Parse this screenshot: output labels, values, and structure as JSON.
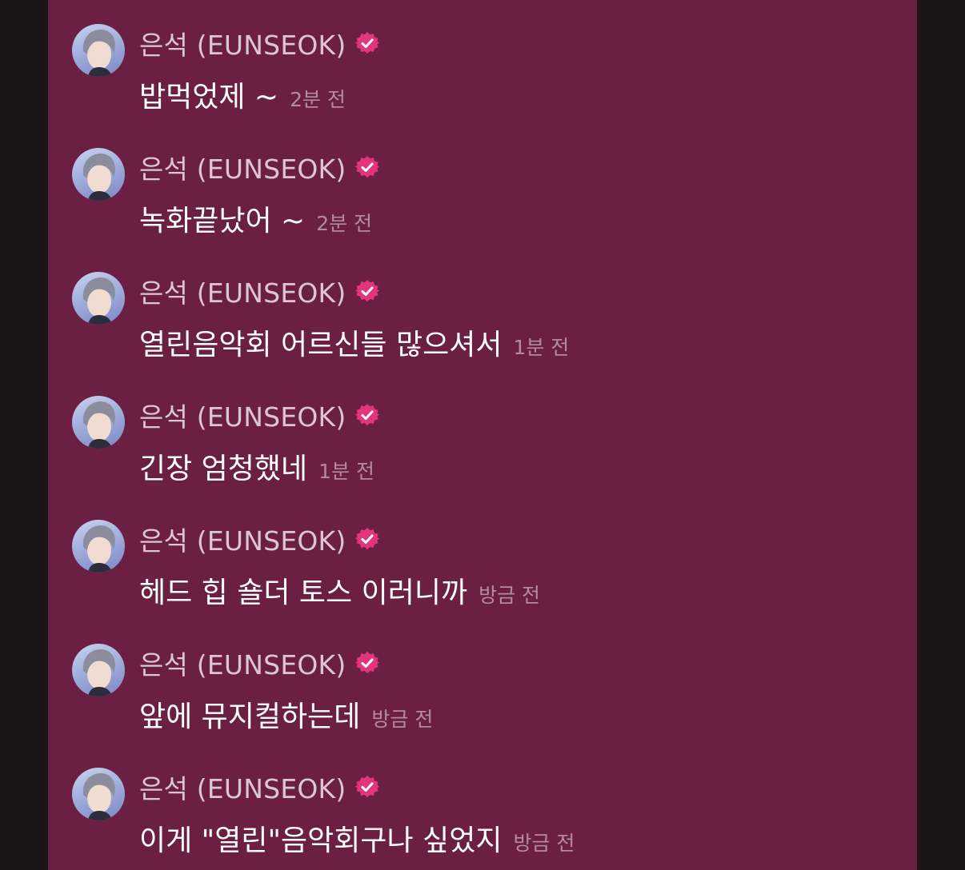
{
  "chat": {
    "messages": [
      {
        "author": "은석 (EUNSEOK)",
        "text": "밥먹었제 ~",
        "time": "2분 전"
      },
      {
        "author": "은석 (EUNSEOK)",
        "text": "녹화끝났어 ~",
        "time": "2분 전"
      },
      {
        "author": "은석 (EUNSEOK)",
        "text": "열린음악회 어르신들 많으셔서",
        "time": "1분 전"
      },
      {
        "author": "은석 (EUNSEOK)",
        "text": "긴장 엄청했네",
        "time": "1분 전"
      },
      {
        "author": "은석 (EUNSEOK)",
        "text": "헤드 힙 숄더 토스 이러니까",
        "time": "방금 전"
      },
      {
        "author": "은석 (EUNSEOK)",
        "text": "앞에 뮤지컬하는데",
        "time": "방금 전"
      },
      {
        "author": "은석 (EUNSEOK)",
        "text": "이게 \"열린\"음악회구나 싶었지",
        "time": "방금 전"
      }
    ],
    "badge_icon": "verified-badge-icon",
    "colors": {
      "panel_bg": "#6a1f43",
      "badge": "#e2357d",
      "text": "#ffffff",
      "name": "#dcc6d1",
      "time": "#b48aa0"
    }
  }
}
